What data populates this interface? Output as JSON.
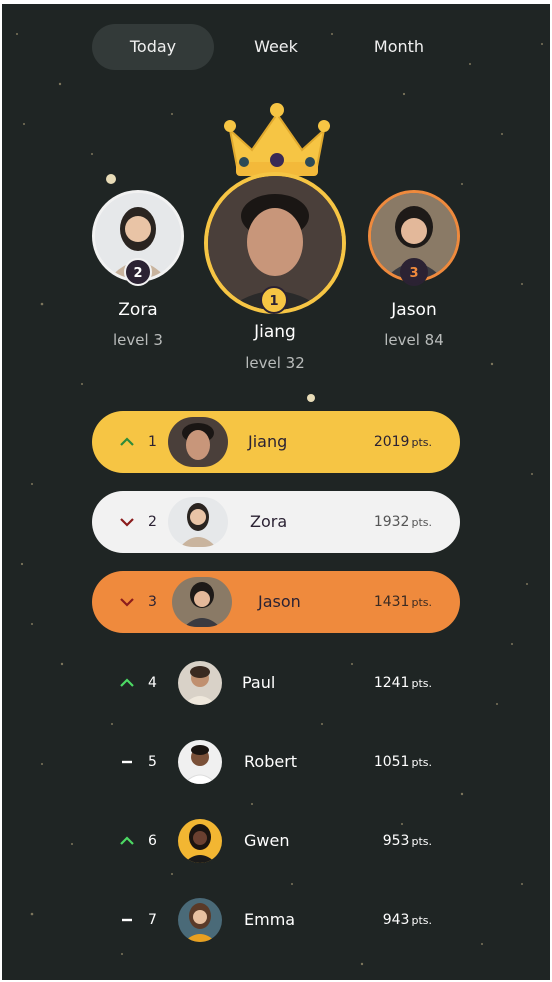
{
  "tabs": [
    {
      "label": "Today",
      "active": true
    },
    {
      "label": "Week",
      "active": false
    },
    {
      "label": "Month",
      "active": false
    }
  ],
  "podium": {
    "first": {
      "rank": "1",
      "name": "Jiang",
      "level": "level 32"
    },
    "second": {
      "rank": "2",
      "name": "Zora",
      "level": "level 3"
    },
    "third": {
      "rank": "3",
      "name": "Jason",
      "level": "level 84"
    }
  },
  "leaderboard": [
    {
      "rank": "1",
      "name": "Jiang",
      "points": "2019",
      "unit": "pts.",
      "trend": "up"
    },
    {
      "rank": "2",
      "name": "Zora",
      "points": "1932",
      "unit": "pts.",
      "trend": "down"
    },
    {
      "rank": "3",
      "name": "Jason",
      "points": "1431",
      "unit": "pts.",
      "trend": "down"
    },
    {
      "rank": "4",
      "name": "Paul",
      "points": "1241",
      "unit": "pts.",
      "trend": "up"
    },
    {
      "rank": "5",
      "name": "Robert",
      "points": "1051",
      "unit": "pts.",
      "trend": "same"
    },
    {
      "rank": "6",
      "name": "Gwen",
      "points": "953",
      "unit": "pts.",
      "trend": "up"
    },
    {
      "rank": "7",
      "name": "Emma",
      "points": "943",
      "unit": "pts.",
      "trend": "same"
    }
  ],
  "colors": {
    "background": "#1f2524",
    "gold": "#f6c544",
    "silver": "#f2f2f2",
    "bronze": "#ef8a3d",
    "trend_up": "#4cd964",
    "trend_down": "#8b1c1c"
  },
  "icons": {
    "crown": "crown-icon",
    "trend_up": "chevron-up-icon",
    "trend_down": "chevron-down-icon",
    "trend_same": "dash-icon"
  }
}
